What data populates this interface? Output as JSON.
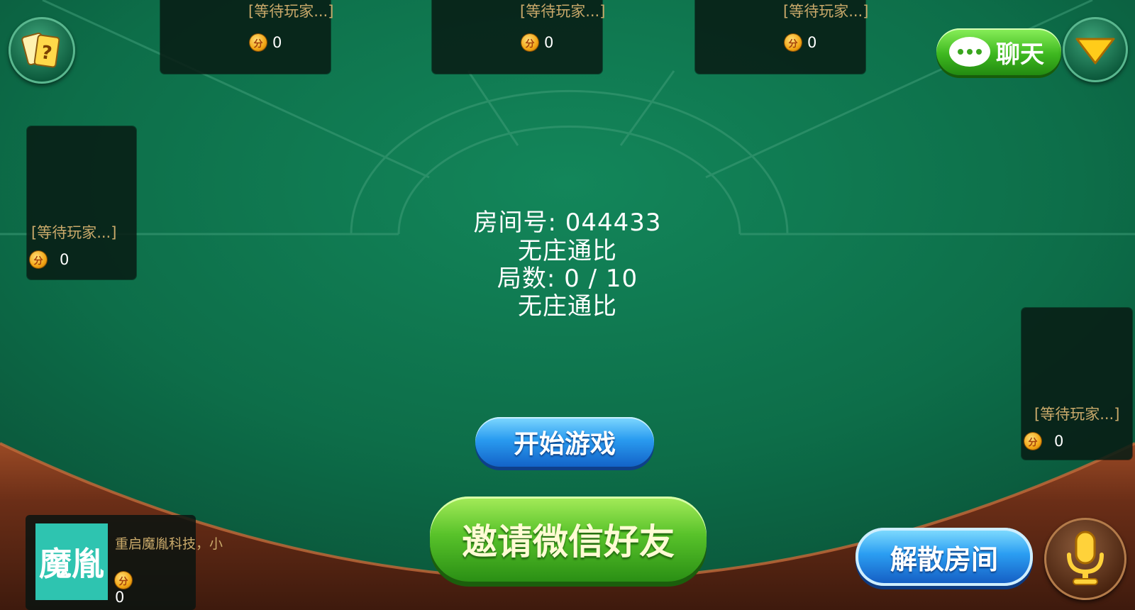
{
  "seats": [
    {
      "name": "[等待玩家...]",
      "score": "0",
      "coin_label": "分"
    },
    {
      "name": "[等待玩家...]",
      "score": "0",
      "coin_label": "分"
    },
    {
      "name": "[等待玩家...]",
      "score": "0",
      "coin_label": "分"
    },
    {
      "name": "[等待玩家...]",
      "score": "0",
      "coin_label": "分"
    },
    {
      "name": "[等待玩家...]",
      "score": "0",
      "coin_label": "分"
    }
  ],
  "room": {
    "room_number": "房间号: 044433",
    "mode": "无庄通比",
    "rounds": "局数: 0 / 10",
    "mode_repeat": "无庄通比"
  },
  "buttons": {
    "start": "开始游戏",
    "invite": "邀请微信好友",
    "dissolve": "解散房间",
    "chat": "聊天"
  },
  "self": {
    "avatar_text": "魔胤",
    "name": "重启魔胤科技，小",
    "score": "0",
    "coin_label": "分"
  },
  "icons": {
    "rules": "rules-card-icon",
    "menu": "chevron-down-icon",
    "mic": "microphone-icon",
    "chat": "chat-bubble-icon"
  },
  "colors": {
    "felt": "#0f7a52",
    "wood": "#5a2a17",
    "seat_name": "#c9a96a"
  }
}
